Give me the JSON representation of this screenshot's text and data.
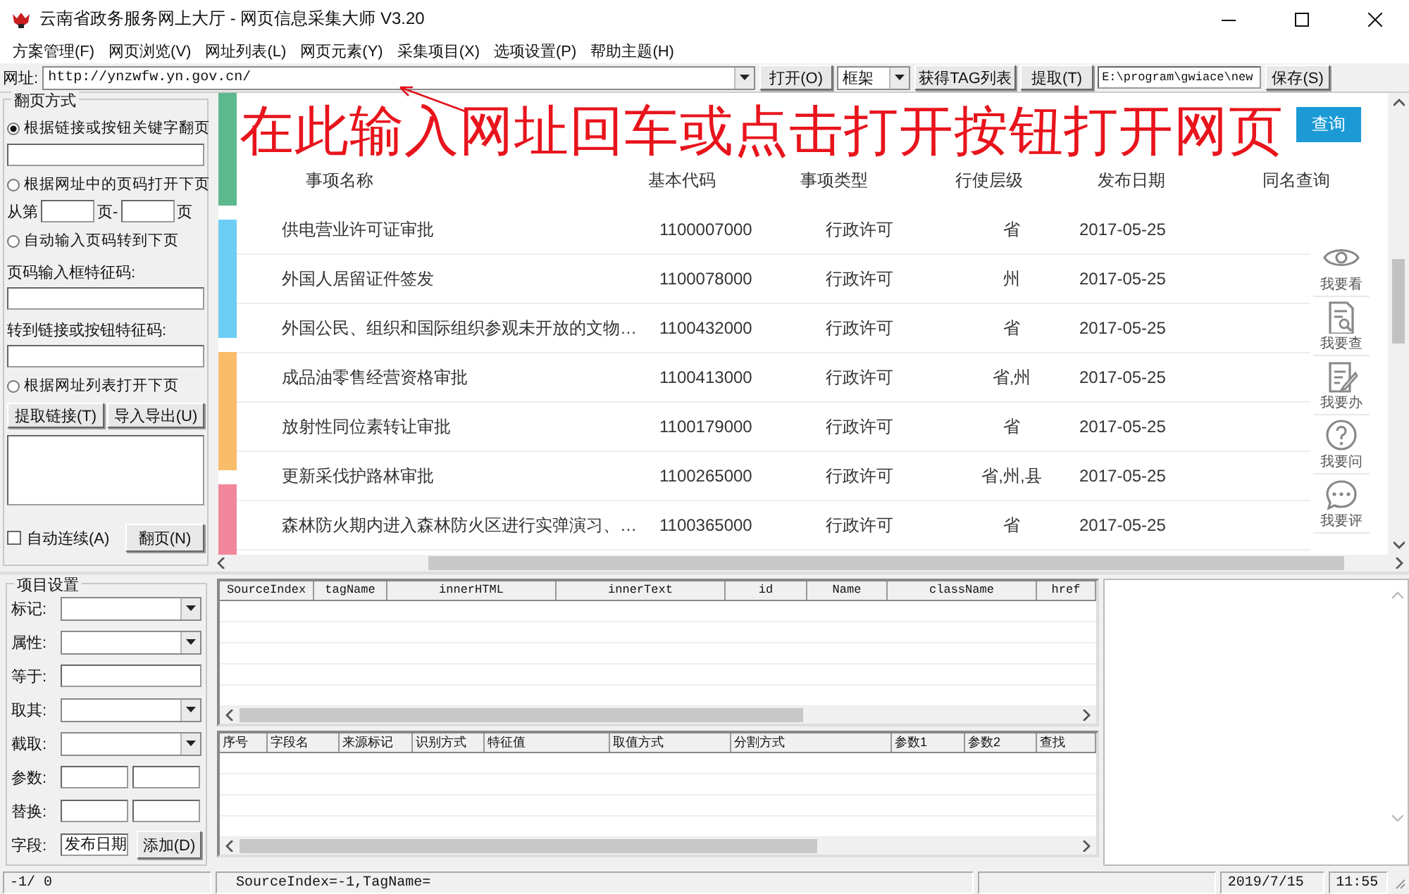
{
  "window": {
    "title": "云南省政务服务网上大厅 - 网页信息采集大师 V3.20"
  },
  "menu": [
    "方案管理(F)",
    "网页浏览(V)",
    "网址列表(L)",
    "网页元素(Y)",
    "采集项目(X)",
    "选项设置(P)",
    "帮助主题(H)"
  ],
  "address_bar": {
    "label": "网址:",
    "url": "http://ynzwfw.yn.gov.cn/",
    "open_button": "打开(O)",
    "frame_select": "框架",
    "tag_button": "获得TAG列表",
    "extract_button": "提取(T)",
    "path": "E:\\program\\gwiace\\new",
    "save_button": "保存(S)"
  },
  "paging": {
    "title": "翻页方式",
    "items": [
      {
        "kind": "radio",
        "label": "根据链接或按钮关键字翻页",
        "selected": true
      },
      {
        "kind": "field"
      },
      {
        "kind": "radio",
        "label": "根据网址中的页码打开下页",
        "selected": false
      },
      {
        "kind": "range",
        "from": "从第",
        "mid": "页-",
        "to": "页"
      },
      {
        "kind": "radio",
        "label": "自动输入页码转到下页",
        "selected": false
      },
      {
        "kind": "label",
        "text": "页码输入框特征码:"
      },
      {
        "kind": "field"
      },
      {
        "kind": "label",
        "text": "转到链接或按钮特征码:"
      },
      {
        "kind": "field"
      },
      {
        "kind": "radio",
        "label": "根据网址列表打开下页",
        "selected": false
      },
      {
        "kind": "buttons",
        "buttons": [
          "提取链接(T)",
          "导入导出(U)"
        ]
      },
      {
        "kind": "textarea"
      },
      {
        "kind": "auto",
        "label": "自动连续(A)",
        "checked": false,
        "button": "翻页(N)"
      }
    ]
  },
  "browser": {
    "annotation": "在此输入网址回车或点击打开按钮打开网页",
    "search_button": "查询",
    "color_strips": [
      {
        "color": "#5cb98e"
      },
      {
        "color": "#6ccdf5"
      },
      {
        "color": "#f9bd6a"
      },
      {
        "color": "#f2879c"
      }
    ],
    "columns": [
      "事项名称",
      "基本代码",
      "事项类型",
      "行使层级",
      "发布日期",
      "同名查询"
    ],
    "rows": [
      {
        "name": "供电营业许可证审批",
        "code": "1100007000",
        "type": "行政许可",
        "level": "省",
        "date": "2017-05-25"
      },
      {
        "name": "外国人居留证件签发",
        "code": "1100078000",
        "type": "行政许可",
        "level": "州",
        "date": "2017-05-25"
      },
      {
        "name": "外国公民、组织和国际组织参观未开放的文物…",
        "code": "1100432000",
        "type": "行政许可",
        "level": "省",
        "date": "2017-05-25"
      },
      {
        "name": "成品油零售经营资格审批",
        "code": "1100413000",
        "type": "行政许可",
        "level": "省,州",
        "date": "2017-05-25"
      },
      {
        "name": "放射性同位素转让审批",
        "code": "1100179000",
        "type": "行政许可",
        "level": "省",
        "date": "2017-05-25"
      },
      {
        "name": "更新采伐护路林审批",
        "code": "1100265000",
        "type": "行政许可",
        "level": "省,州,县",
        "date": "2017-05-25"
      },
      {
        "name": "森林防火期内进入森林防火区进行实弹演习、…",
        "code": "1100365000",
        "type": "行政许可",
        "level": "省",
        "date": "2017-05-25"
      }
    ],
    "side_tools": [
      "我要看",
      "我要查",
      "我要办",
      "我要问",
      "我要评"
    ]
  },
  "project": {
    "title": "项目设置",
    "rows": [
      {
        "label": "标记:",
        "kind": "combo"
      },
      {
        "label": "属性:",
        "kind": "combo"
      },
      {
        "label": "等于:",
        "kind": "field"
      },
      {
        "label": "取其:",
        "kind": "combo"
      },
      {
        "label": "截取:",
        "kind": "combo"
      },
      {
        "label": "参数:",
        "kind": "pair"
      },
      {
        "label": "替换:",
        "kind": "pair"
      },
      {
        "label": "字段:",
        "kind": "field-button",
        "value": "发布日期",
        "button": "添加(D)"
      }
    ]
  },
  "element_grid": {
    "columns": [
      "SourceIndex",
      "tagName",
      "innerHTML",
      "innerText",
      "id",
      "Name",
      "className",
      "href"
    ]
  },
  "field_grid": {
    "columns": [
      "序号",
      "字段名",
      "来源标记",
      "识别方式",
      "特征值",
      "取值方式",
      "分割方式",
      "参数1",
      "参数2",
      "查找"
    ]
  },
  "status_bar": {
    "position": "-1/ 0",
    "element": "SourceIndex=-1,TagName=",
    "date": "2019/7/15",
    "time": "11:55"
  }
}
